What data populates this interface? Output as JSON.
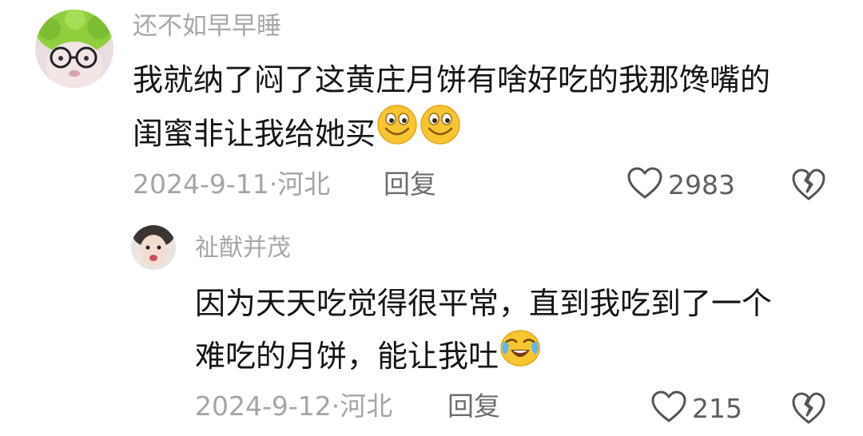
{
  "comments": [
    {
      "username": "还不如早早睡",
      "lines": [
        "我就纳了闷了这黄庄月饼有啥好吃的我那馋嘴的",
        "闺蜜非让我给她买"
      ],
      "emojis": [
        "smile-emoji",
        "smile-emoji"
      ],
      "date": "2024-9-11·河北",
      "reply_label": "回复",
      "likes": "2983"
    },
    {
      "username": "祉猷并茂",
      "lines": [
        "因为天天吃觉得很平常，直到我吃到了一个",
        "难吃的月饼，能让我吐"
      ],
      "emojis": [
        "crying-laughing-emoji"
      ],
      "date": "2024-9-12·河北",
      "reply_label": "回复",
      "likes": "215"
    }
  ],
  "icons": {
    "like": "heart-outline-icon",
    "dislike": "broken-heart-icon"
  },
  "colors": {
    "username": "#a8a8a8",
    "text": "#151515",
    "meta": "#a5a5a5",
    "emoji_yellow": "#f7c531"
  }
}
